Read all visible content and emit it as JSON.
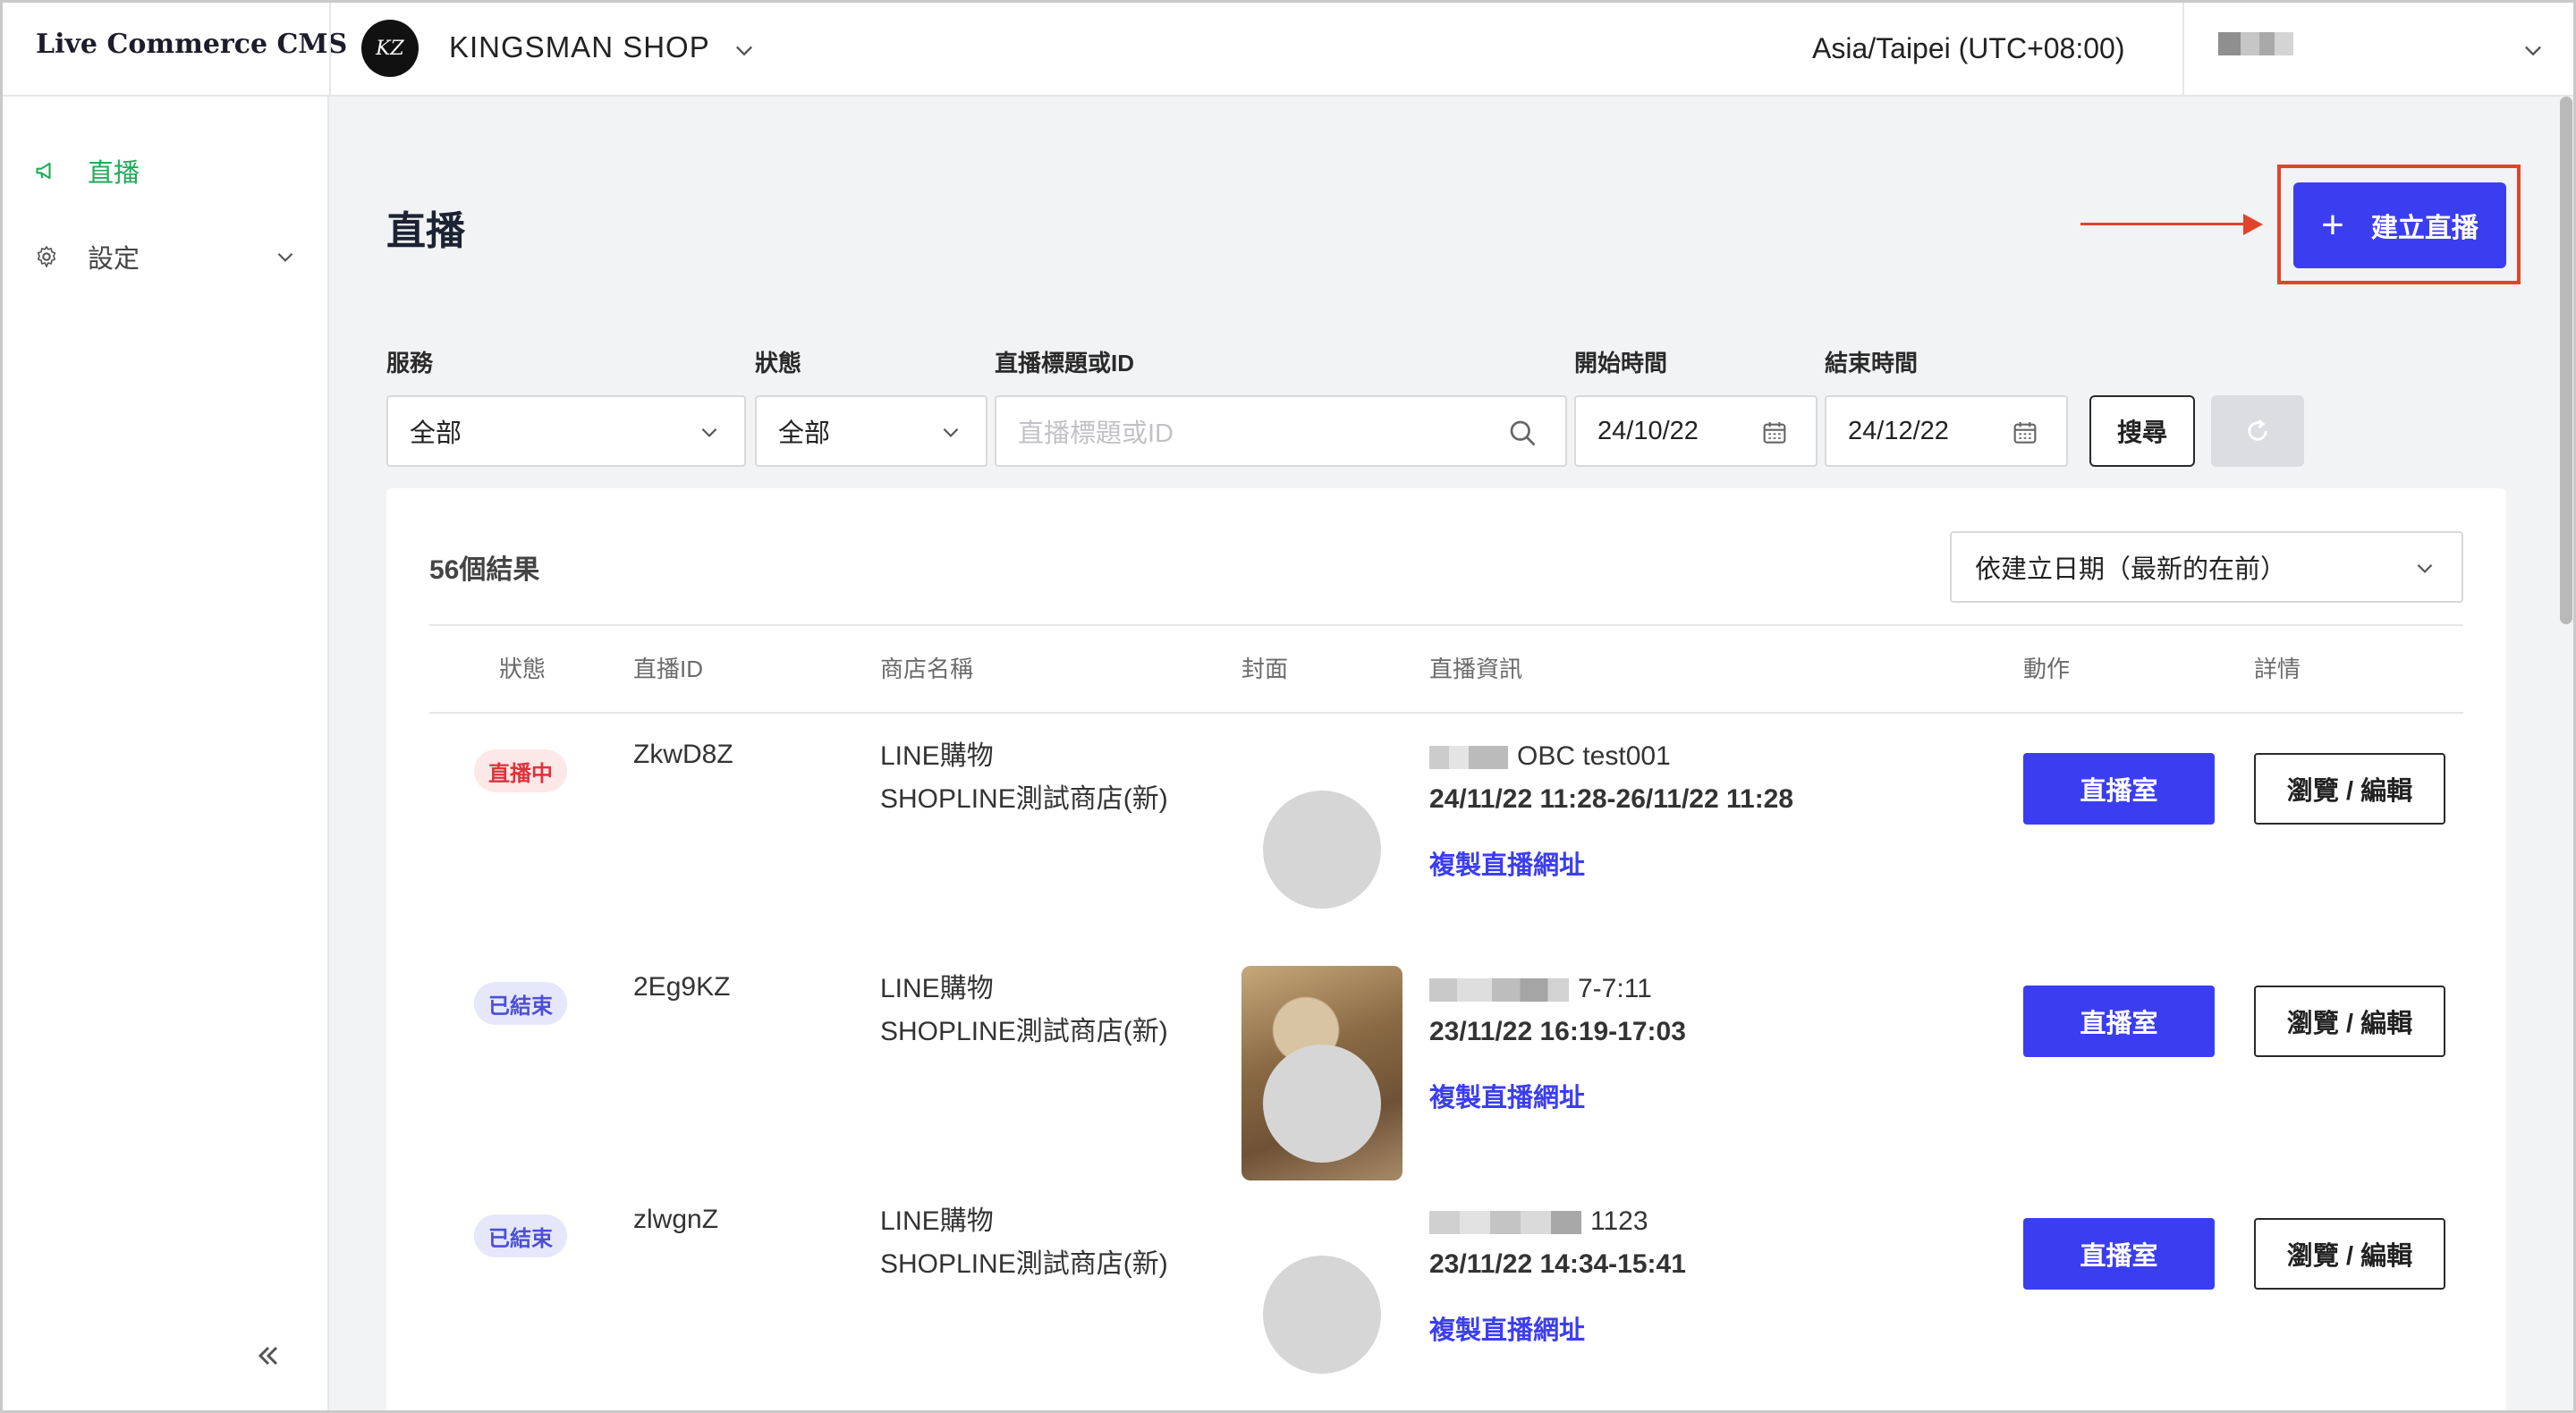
{
  "app": {
    "brand": "Live Commerce CMS",
    "shop_name": "KINGSMAN SHOP",
    "shop_logo_text": "KZ",
    "timezone": "Asia/Taipei (UTC+08:00)"
  },
  "sidebar": {
    "items": [
      {
        "label": "直播",
        "icon": "megaphone-icon",
        "active": true
      },
      {
        "label": "設定",
        "icon": "gear-icon",
        "active": false
      }
    ]
  },
  "page": {
    "title": "直播",
    "create_button": "建立直播"
  },
  "filters": {
    "service": {
      "label": "服務",
      "value": "全部"
    },
    "status": {
      "label": "狀態",
      "value": "全部"
    },
    "keyword": {
      "label": "直播標題或ID",
      "placeholder": "直播標題或ID"
    },
    "start": {
      "label": "開始時間",
      "value": "24/10/22"
    },
    "end": {
      "label": "結束時間",
      "value": "24/12/22"
    },
    "search_button": "搜尋"
  },
  "results": {
    "count_text": "56個結果",
    "sort": "依建立日期（最新的在前）",
    "columns": [
      "狀態",
      "直播ID",
      "商店名稱",
      "封面",
      "直播資訊",
      "動作",
      "詳情"
    ],
    "rows": [
      {
        "status": "直播中",
        "status_type": "live",
        "id": "ZkwD8Z",
        "shop_line1": "LINE購物",
        "shop_line2": "SHOPLINE測試商店(新)",
        "title_suffix": "OBC test001",
        "time": "24/11/22 11:28-26/11/22 11:28",
        "copy": "複製直播網址",
        "room": "直播室",
        "edit": "瀏覽 / 編輯",
        "cover": "placeholder"
      },
      {
        "status": "已結束",
        "status_type": "ended",
        "id": "2Eg9KZ",
        "shop_line1": "LINE購物",
        "shop_line2": "SHOPLINE測試商店(新)",
        "title_suffix": "7-7:11",
        "time": "23/11/22 16:19-17:03",
        "copy": "複製直播網址",
        "room": "直播室",
        "edit": "瀏覽 / 編輯",
        "cover": "photo"
      },
      {
        "status": "已結束",
        "status_type": "ended",
        "id": "zlwgnZ",
        "shop_line1": "LINE購物",
        "shop_line2": "SHOPLINE測試商店(新)",
        "title_suffix": "1123",
        "time": "23/11/22 14:34-15:41",
        "copy": "複製直播網址",
        "room": "直播室",
        "edit": "瀏覽 / 編輯",
        "cover": "placeholder"
      }
    ]
  },
  "colors": {
    "accent": "#3b3ef0",
    "active_nav": "#1faa59",
    "annotation": "#e0452a"
  }
}
